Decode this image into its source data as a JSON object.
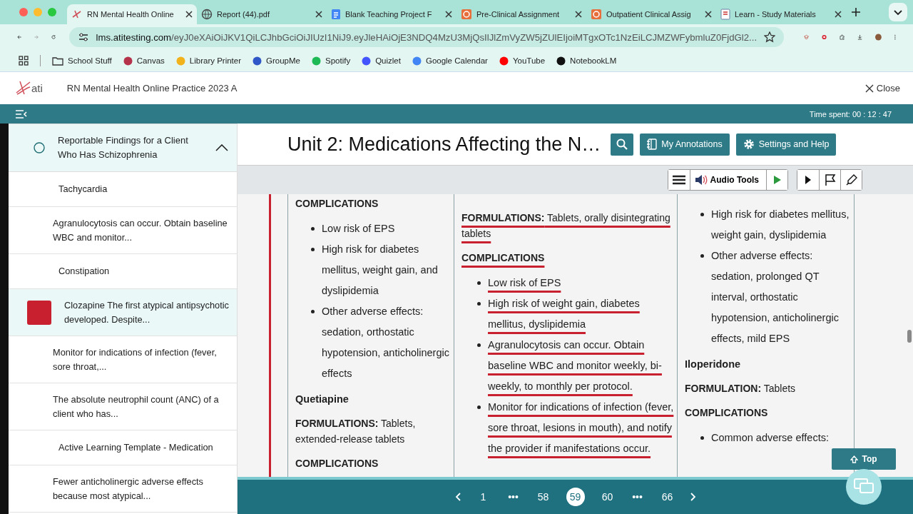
{
  "browser": {
    "tabs": [
      {
        "title": "RN Mental Health Online",
        "kind": "ati",
        "selected": true
      },
      {
        "title": "Report (44).pdf",
        "kind": "globe",
        "selected": false
      },
      {
        "title": "Blank Teaching Project F",
        "kind": "doc",
        "selected": false
      },
      {
        "title": "Pre-Clinical Assignment",
        "kind": "clinic",
        "selected": false
      },
      {
        "title": "Outpatient Clinical Assig",
        "kind": "clinic",
        "selected": false
      },
      {
        "title": "Learn - Study Materials",
        "kind": "page",
        "selected": false
      }
    ],
    "address": {
      "domain": "lms.atitesting.com",
      "path": "/eyJ0eXAiOiJKV1QiLCJhbGciOiJIUzI1NiJ9.eyJleHAiOjE3NDQ4MzU3MjQsIlJlZmVyZW5jZUlEIjoiMTgxOTc1NzEiLCJMZWFybmluZ0FjdGl2..."
    },
    "bookmarks": [
      {
        "label": "School Stuff",
        "kind": "folder"
      },
      {
        "label": "Canvas",
        "kind": "site",
        "color": "#b5334a"
      },
      {
        "label": "Library Printer",
        "kind": "site",
        "color": "#f2b21b"
      },
      {
        "label": "GroupMe",
        "kind": "site",
        "color": "#2f57c7"
      },
      {
        "label": "Spotify",
        "kind": "site",
        "color": "#1db954"
      },
      {
        "label": "Quizlet",
        "kind": "site",
        "color": "#4255ff"
      },
      {
        "label": "Google Calendar",
        "kind": "site",
        "color": "#4285f4"
      },
      {
        "label": "YouTube",
        "kind": "site",
        "color": "#ff0000"
      },
      {
        "label": "NotebookLM",
        "kind": "site",
        "color": "#111111"
      }
    ]
  },
  "app": {
    "logo": "ati",
    "course": "RN Mental Health Online Practice 2023 A",
    "close": "Close",
    "time": "Time spent: 00 : 12 : 47"
  },
  "sidebar": {
    "header": {
      "title": "Reportable Findings for a Client Who Has Schizophrenia",
      "expanded": true
    },
    "items": [
      {
        "text": "Tachycardia",
        "kind": "label",
        "selected": false
      },
      {
        "text": "Agranulocytosis can occur. Obtain baseline WBC and monitor...",
        "kind": "note",
        "selected": false
      },
      {
        "text": "Constipation",
        "kind": "label",
        "selected": false
      },
      {
        "text": "Clozapine The first atypical antipsychotic developed. Despite...",
        "kind": "highlight",
        "selected": true
      },
      {
        "text": "Monitor for indications of infection (fever, sore throat,...",
        "kind": "note",
        "selected": false
      },
      {
        "text": "The absolute neutrophil count (ANC) of a client who has...",
        "kind": "note",
        "selected": false
      },
      {
        "text": "Active Learning Template - Medication",
        "kind": "label",
        "selected": false
      },
      {
        "text": "Fewer anticholinergic adverse effects because most atypical...",
        "kind": "note",
        "selected": false
      }
    ]
  },
  "page": {
    "title": "Unit 2: Medications Affecting the N…",
    "annotations": "My Annotations",
    "settings": "Settings and Help",
    "audio": "Audio Tools",
    "top": "Top"
  },
  "columns": [
    {
      "annotated": true,
      "blocks": [
        {
          "kind": "heading",
          "text": "COMPLICATIONS",
          "underlined": false
        },
        {
          "kind": "bullets",
          "underlined": false,
          "items": [
            "Low risk of EPS",
            "High risk for diabetes mellitus, weight gain, and dyslipidemia",
            "Other adverse effects: sedation, orthostatic hypotension, anticholinergic effects"
          ]
        },
        {
          "kind": "drug",
          "text": "Quetiapine",
          "underlined": false
        },
        {
          "kind": "field",
          "text": "**FORMULATIONS:** Tablets, extended-release tablets",
          "underlined": false
        },
        {
          "kind": "heading",
          "text": "COMPLICATIONS",
          "underlined": false
        }
      ]
    },
    {
      "annotated": false,
      "blocks": [
        {
          "kind": "field",
          "text": "**FORMULATIONS:** Tablets, orally disintegrating tablets",
          "underlined": true
        },
        {
          "kind": "heading",
          "text": "COMPLICATIONS",
          "underlined": true
        },
        {
          "kind": "bullets",
          "underlined": true,
          "items": [
            "Low risk of EPS",
            "High risk of weight gain, diabetes mellitus, dyslipidemia",
            "Agranulocytosis can occur. Obtain baseline WBC and monitor weekly, bi-weekly, to monthly per protocol.",
            "Monitor for indications of infection (fever, sore throat, lesions in mouth), and notify the provider if manifestations occur."
          ]
        }
      ]
    },
    {
      "annotated": false,
      "blocks": [
        {
          "kind": "bullets",
          "underlined": false,
          "items": [
            "High risk for diabetes mellitus, weight gain, dyslipidemia",
            "Other adverse effects: sedation, prolonged QT interval, orthostatic hypotension, anticholinergic effects, mild EPS"
          ]
        },
        {
          "kind": "drug",
          "text": "Iloperidone",
          "underlined": false
        },
        {
          "kind": "field",
          "text": "**FORMULATION:** Tablets",
          "underlined": false
        },
        {
          "kind": "heading",
          "text": "COMPLICATIONS",
          "underlined": false
        },
        {
          "kind": "bullets",
          "underlined": false,
          "items": [
            "Common adverse effects:"
          ]
        }
      ]
    }
  ],
  "pagination": [
    {
      "label": "1",
      "selected": false
    },
    {
      "label": "•••",
      "selected": false
    },
    {
      "label": "58",
      "selected": false
    },
    {
      "label": "59",
      "selected": true
    },
    {
      "label": "60",
      "selected": false
    },
    {
      "label": "•••",
      "selected": false
    },
    {
      "label": "66",
      "selected": false
    }
  ]
}
